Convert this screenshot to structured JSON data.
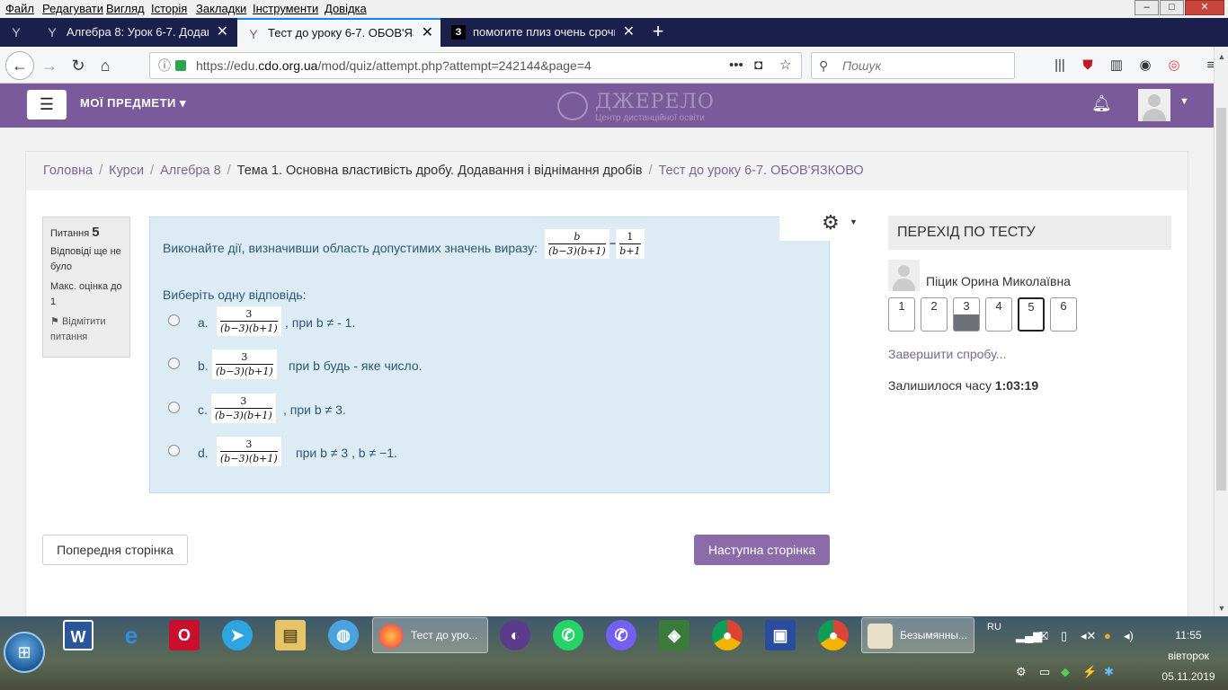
{
  "menubar": {
    "items": [
      "Файл",
      "Редагувати",
      "Вигляд",
      "Історія",
      "Закладки",
      "Інструменти",
      "Довідка"
    ]
  },
  "window_controls": {
    "minimize": "–",
    "maximize": "□",
    "close": "✕"
  },
  "tabs": [
    {
      "title": "Алгебра 8: Урок 6-7. Додаванн"
    },
    {
      "title": "Тест до уроку 6-7. ОБОВ'ЯЗКО"
    },
    {
      "title": "помогите плиз очень срочно"
    }
  ],
  "tab_icon_z": "З",
  "newtab_label": "+",
  "navbar": {
    "url_prefix": "https://edu.",
    "url_domain": "cdo.org.ua",
    "url_path": "/mod/quiz/attempt.php?attempt=242144&page=4",
    "search_placeholder": "Пошук"
  },
  "site": {
    "menu_title": "МОЇ ПРЕДМЕТИ",
    "logo_title": "ДЖЕРЕЛО",
    "logo_subtitle": "Центр дистанційної освіти"
  },
  "breadcrumbs": [
    {
      "label": "Головна"
    },
    {
      "label": "Курси"
    },
    {
      "label": "Алгебра 8"
    },
    {
      "label": "Тема 1. Основна властивість дробу. Додавання і віднімання дробів"
    },
    {
      "label": "Тест до уроку 6-7. ОБОВ'ЯЗКОВО"
    }
  ],
  "breadcrumb_sep": "/",
  "question_info": {
    "label": "Питання",
    "number": "5",
    "status": "Відповіді ще не було",
    "max_grade": "Макс. оцінка до 1",
    "flag_label": "Відмітити питання"
  },
  "question": {
    "text": "Виконайте дії, визначивши область допустимих значень виразу:",
    "expr": {
      "num1": "b",
      "den1": "(b−3)(b+1)",
      "minus": "−",
      "num2": "1",
      "den2": "b+1"
    },
    "choose_label": "Виберіть одну відповідь:",
    "options": [
      {
        "letter": "a.",
        "num": "3",
        "den": "(b−3)(b+1)",
        "condition": ", при  b ≠ - 1."
      },
      {
        "letter": "b.",
        "num": "3",
        "den": "(b−3)(b+1)",
        "condition": "при b будь - яке число."
      },
      {
        "letter": "c.",
        "num": "3",
        "den": "(b−3)(b+1)",
        "condition": ", при b ≠ 3."
      },
      {
        "letter": "d.",
        "num": "3",
        "den": "(b−3)(b+1)",
        "condition": "при b ≠  3 , b ≠ −1."
      }
    ]
  },
  "quiz_nav": {
    "title": "ПЕРЕХІД ПО ТЕСТУ",
    "user_name": "Піцик Орина Миколаївна",
    "questions": [
      "1",
      "2",
      "3",
      "4",
      "5",
      "6"
    ],
    "answered": [
      "3"
    ],
    "current": "5",
    "finish_label": "Завершити спробу...",
    "timer_label": "Залишилося часу",
    "timer_value": "1:03:19"
  },
  "buttons": {
    "prev": "Попередня сторінка",
    "next": "Наступна сторінка"
  },
  "taskbar": {
    "firefox_task": "Тест до уро...",
    "paint_task": "Безымянны...",
    "lang": "RU",
    "time": "11:55",
    "weekday": "вівторок",
    "date": "05.11.2019"
  },
  "colors": {
    "purple": "#7a5a9a",
    "question_bg": "#dcebf4",
    "next_button": "#8c6ca8",
    "tabbar": "#1b1f4c"
  }
}
